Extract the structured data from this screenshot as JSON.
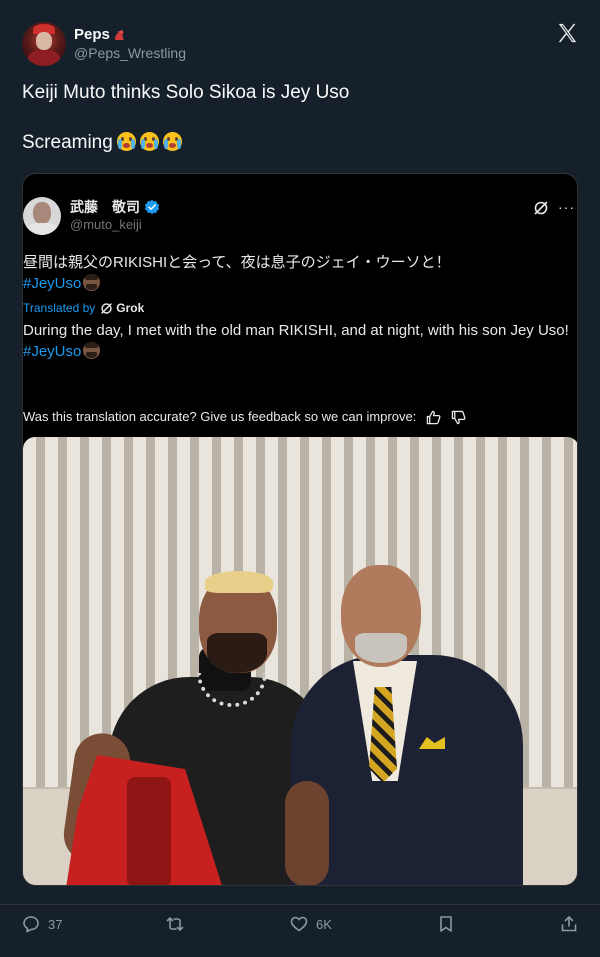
{
  "author": {
    "display_name": "Peps",
    "handle": "@Peps_Wrestling"
  },
  "tweet": {
    "line1": "Keiji Muto thinks Solo Sikoa is Jey Uso",
    "line2": "Screaming",
    "emoji": "loudly-crying-face"
  },
  "quoted": {
    "display_name": "武藤　敬司",
    "handle": "@muto_keiji",
    "original_text": "昼間は親父のRIKISHIと会って、夜は息子のジェイ・ウーソと！",
    "hashtag": "#JeyUso",
    "translated_label": "Translated by",
    "translator": "Grok",
    "translation": "During the day, I met with the old man RIKISHI, and at night, with his son Jey Uso!",
    "hashtag2": "#JeyUso",
    "feedback_text": "Was this translation accurate? Give us feedback so we can improve:",
    "more": "···"
  },
  "actions": {
    "replies": "37",
    "likes": "6K"
  },
  "colors": {
    "background": "#16202a",
    "link": "#1d9bf0",
    "muted": "#8b98a5"
  }
}
